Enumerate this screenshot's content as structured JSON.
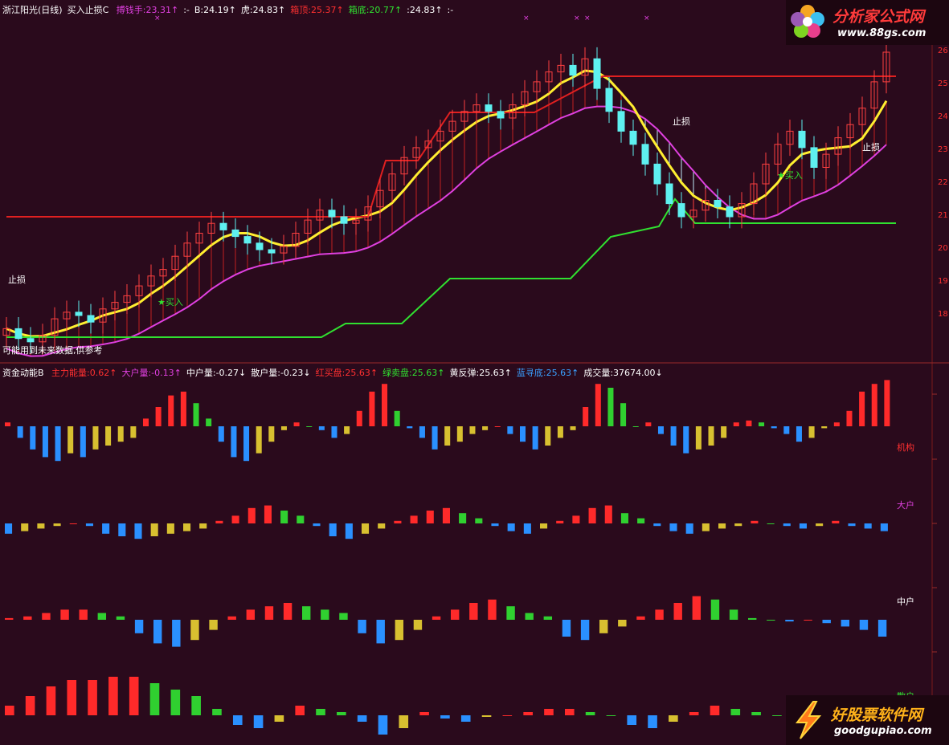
{
  "upper": {
    "name": "浙江阳光(日线)",
    "indicator": "买入止损C",
    "items": [
      {
        "label": "搏钱手:23.31↑",
        "color": "#e040e0"
      },
      {
        "label": ":-",
        "color": "#ffffff"
      },
      {
        "label": "B:24.19↑",
        "color": "#ffffff"
      },
      {
        "label": "虎:24.83↑",
        "color": "#ffffff"
      },
      {
        "label": "箱顶:25.37↑",
        "color": "#ff3030"
      },
      {
        "label": "箱底:20.77↑",
        "color": "#30e030"
      },
      {
        "label": ":24.83↑",
        "color": "#ffffff"
      },
      {
        "label": ":-",
        "color": "#ffffff"
      }
    ],
    "note": "可能用到未来数据,供参考",
    "marker_stop": "止损",
    "marker_buy": "买入",
    "x_marker": "×",
    "y_ticks": [
      "26",
      "25",
      "24",
      "23",
      "22",
      "21",
      "20",
      "19",
      "18"
    ],
    "box_top": 25.37,
    "box_bottom": 20.77
  },
  "lower": {
    "name": "资金动能B",
    "items": [
      {
        "label": "主力能量:0.62↑",
        "color": "#ff3030"
      },
      {
        "label": "大户量:-0.13↑",
        "color": "#e040e0"
      },
      {
        "label": "中户量:-0.27↓",
        "color": "#ffffff"
      },
      {
        "label": "散户量:-0.23↓",
        "color": "#ffffff"
      },
      {
        "label": "红买盘:25.63↑",
        "color": "#ff3030"
      },
      {
        "label": "绿卖盘:25.63↑",
        "color": "#30e030"
      },
      {
        "label": "黄反弹:25.63↑",
        "color": "#ffffff"
      },
      {
        "label": "蓝寻底:25.63↑",
        "color": "#3aa0ff"
      },
      {
        "label": "成交量:37674.00↓",
        "color": "#ffffff"
      }
    ],
    "pane_labels": [
      "机构",
      "大户",
      "中户",
      "散户"
    ]
  },
  "watermarks": {
    "top_title": "分析家公式网",
    "top_url": "www.88gs.com",
    "bottom_title": "好股票软件网",
    "bottom_url": "goodgupiao.com"
  },
  "chart_data": {
    "type": "candlestick-with-histograms",
    "closes": [
      17.6,
      17.3,
      17.2,
      17.4,
      17.9,
      18.1,
      18.0,
      17.8,
      18.2,
      18.4,
      18.6,
      18.9,
      19.2,
      19.4,
      19.8,
      20.2,
      20.5,
      20.8,
      20.6,
      20.4,
      20.2,
      20.0,
      19.9,
      20.1,
      20.5,
      20.9,
      21.2,
      21.0,
      20.8,
      20.9,
      21.3,
      21.8,
      22.3,
      22.8,
      23.1,
      23.3,
      23.6,
      23.9,
      24.2,
      24.4,
      24.2,
      24.0,
      24.4,
      24.8,
      25.1,
      25.4,
      25.6,
      25.3,
      25.8,
      24.9,
      24.2,
      23.6,
      23.2,
      22.6,
      22.0,
      21.4,
      21.0,
      21.2,
      21.5,
      21.3,
      21.0,
      21.4,
      22.0,
      22.6,
      23.2,
      23.6,
      23.1,
      22.5,
      22.9,
      23.4,
      23.8,
      24.3,
      25.1,
      26.0
    ],
    "series": [
      {
        "name": "机构",
        "values": [
          0.1,
          -0.3,
          -0.6,
          -0.8,
          -0.9,
          -0.7,
          -0.8,
          -0.6,
          -0.5,
          -0.4,
          -0.3,
          0.2,
          0.5,
          0.8,
          0.9,
          0.6,
          0.2,
          -0.4,
          -0.8,
          -0.9,
          -0.7,
          -0.4,
          -0.1,
          0.1,
          0.0,
          -0.1,
          -0.3,
          -0.2,
          0.4,
          0.9,
          1.1,
          0.4,
          -0.05,
          -0.3,
          -0.6,
          -0.5,
          -0.4,
          -0.2,
          -0.1,
          0.0,
          -0.2,
          -0.4,
          -0.6,
          -0.5,
          -0.3,
          -0.1,
          0.5,
          1.1,
          1.0,
          0.6,
          0.0,
          0.1,
          -0.2,
          -0.5,
          -0.7,
          -0.6,
          -0.5,
          -0.3,
          0.1,
          0.15,
          0.1,
          -0.05,
          -0.2,
          -0.4,
          -0.3,
          -0.05,
          0.1,
          0.4,
          0.9,
          1.1,
          1.2
        ]
      },
      {
        "name": "大户",
        "values": [
          -0.4,
          -0.3,
          -0.2,
          -0.1,
          0.0,
          -0.1,
          -0.4,
          -0.5,
          -0.6,
          -0.5,
          -0.4,
          -0.3,
          -0.2,
          0.1,
          0.3,
          0.6,
          0.7,
          0.5,
          0.3,
          -0.1,
          -0.5,
          -0.6,
          -0.4,
          -0.2,
          0.1,
          0.3,
          0.5,
          0.6,
          0.4,
          0.2,
          -0.1,
          -0.3,
          -0.4,
          -0.2,
          0.1,
          0.3,
          0.6,
          0.7,
          0.4,
          0.2,
          -0.1,
          -0.3,
          -0.4,
          -0.3,
          -0.2,
          -0.1,
          0.1,
          0.0,
          -0.1,
          -0.2,
          -0.1,
          0.1,
          -0.1,
          -0.2,
          -0.3
        ]
      },
      {
        "name": "中户",
        "values": [
          0.05,
          0.1,
          0.2,
          0.3,
          0.3,
          0.2,
          0.1,
          -0.4,
          -0.7,
          -0.8,
          -0.6,
          -0.3,
          0.1,
          0.3,
          0.4,
          0.5,
          0.4,
          0.3,
          0.2,
          -0.4,
          -0.7,
          -0.6,
          -0.3,
          0.1,
          0.3,
          0.5,
          0.6,
          0.4,
          0.2,
          0.1,
          -0.5,
          -0.6,
          -0.4,
          -0.2,
          0.1,
          0.3,
          0.5,
          0.7,
          0.6,
          0.3,
          0.05,
          0.0,
          -0.05,
          0.0,
          -0.1,
          -0.2,
          -0.3,
          -0.5
        ]
      },
      {
        "name": "散户",
        "values": [
          0.3,
          0.6,
          0.9,
          1.1,
          1.1,
          1.2,
          1.2,
          1.0,
          0.8,
          0.6,
          0.2,
          -0.3,
          -0.4,
          -0.2,
          0.3,
          0.2,
          0.1,
          -0.2,
          -0.6,
          -0.4,
          0.1,
          -0.1,
          -0.2,
          -0.05,
          0.0,
          0.1,
          0.2,
          0.2,
          0.1,
          0.0,
          -0.3,
          -0.4,
          -0.2,
          0.1,
          0.3,
          0.2,
          0.1,
          0.0,
          0.1,
          0.2,
          0.3,
          0.2,
          0.1
        ]
      }
    ]
  }
}
